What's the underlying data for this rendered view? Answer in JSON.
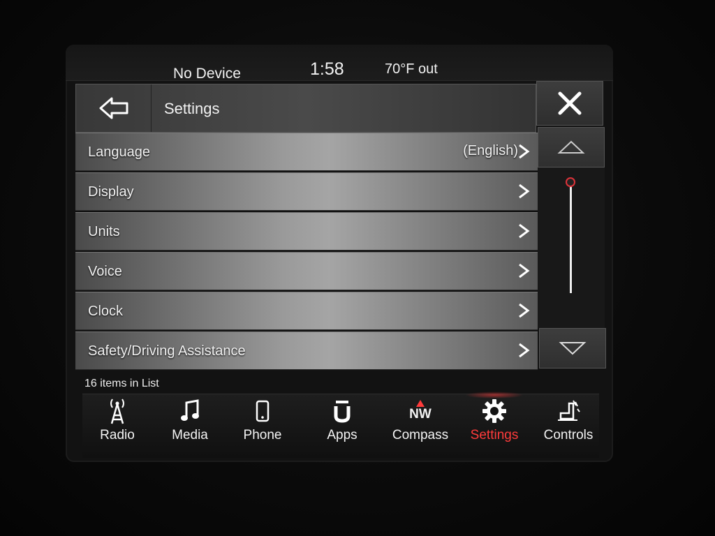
{
  "status": {
    "device": "No Device",
    "time": "1:58",
    "temperature": "70°F out"
  },
  "header": {
    "title": "Settings",
    "back_icon": "back-arrow-icon",
    "close_icon": "close-icon"
  },
  "list": {
    "items": [
      {
        "label": "Language",
        "value": "(English)"
      },
      {
        "label": "Display",
        "value": ""
      },
      {
        "label": "Units",
        "value": ""
      },
      {
        "label": "Voice",
        "value": ""
      },
      {
        "label": "Clock",
        "value": ""
      },
      {
        "label": "Safety/Driving Assistance",
        "value": ""
      }
    ],
    "count_text": "16 items in List"
  },
  "scroll": {
    "up_icon": "triangle-up-icon",
    "down_icon": "triangle-down-icon",
    "position_fraction": 0.0
  },
  "nav": {
    "items": [
      {
        "label": "Radio",
        "icon": "radio-antenna-icon",
        "active": false
      },
      {
        "label": "Media",
        "icon": "music-note-icon",
        "active": false
      },
      {
        "label": "Phone",
        "icon": "phone-icon",
        "active": false
      },
      {
        "label": "Apps",
        "icon": "apps-icon",
        "active": false
      },
      {
        "label": "Compass",
        "icon": "compass-icon",
        "badge": "NW",
        "active": false
      },
      {
        "label": "Settings",
        "icon": "gear-icon",
        "active": true
      },
      {
        "label": "Controls",
        "icon": "seat-controls-icon",
        "active": false
      }
    ]
  },
  "colors": {
    "accent_active": "#ff3b3b",
    "scroll_thumb": "#e0333a"
  }
}
